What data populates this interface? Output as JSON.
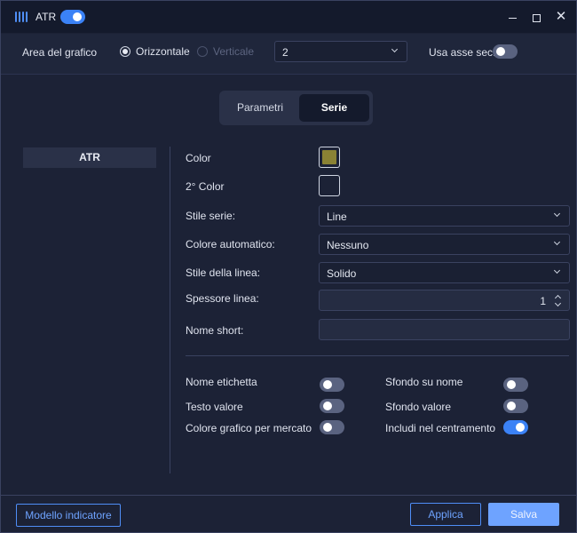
{
  "window": {
    "title": "ATR",
    "title_toggle_on": true,
    "controls": {
      "minimize": "minimize-icon",
      "maximize": "maximize-icon",
      "close": "close-icon"
    }
  },
  "area": {
    "label": "Area del grafico",
    "options": [
      {
        "label": "Orizzontale",
        "checked": true,
        "disabled": false
      },
      {
        "label": "Verticale",
        "checked": false,
        "disabled": true
      }
    ],
    "select_value": "2",
    "secondary_axis_label": "Usa asse sec.",
    "secondary_axis_on": false
  },
  "tabs": [
    {
      "label": "Parametri",
      "active": false
    },
    {
      "label": "Serie",
      "active": true
    }
  ],
  "series_list": [
    {
      "label": "ATR",
      "selected": true
    }
  ],
  "form": {
    "color_label": "Color",
    "color_value": "#8a8234",
    "color2_label": "2° Color",
    "color2_value": "",
    "series_style_label": "Stile serie:",
    "series_style_value": "Line",
    "auto_color_label": "Colore automatico:",
    "auto_color_value": "Nessuno",
    "line_style_label": "Stile della linea:",
    "line_style_value": "Solido",
    "line_width_label": "Spessore linea:",
    "line_width_value": "1",
    "short_name_label": "Nome short:",
    "short_name_value": ""
  },
  "toggles": [
    {
      "label": "Nome etichetta",
      "on": false
    },
    {
      "label": "Sfondo su nome",
      "on": false
    },
    {
      "label": "Testo valore",
      "on": false
    },
    {
      "label": "Sfondo valore",
      "on": false
    },
    {
      "label": "Colore grafico per mercato",
      "on": false
    },
    {
      "label": "Includi nel centramento",
      "on": true
    }
  ],
  "footer": {
    "indicator_model_label": "Modello indicatore",
    "apply_label": "Applica",
    "save_label": "Salva"
  },
  "colors": {
    "accent": "#3b82f6",
    "button_primary": "#6ea3ff",
    "background": "#1c2236"
  }
}
